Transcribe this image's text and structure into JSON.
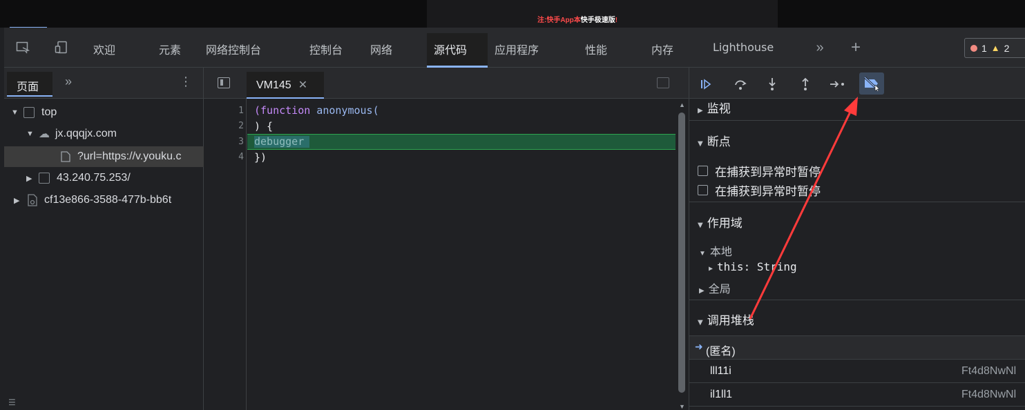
{
  "video": {
    "caption_red": "注:快手App本",
    "caption_white": "快手极速版",
    "caption_tail": "!"
  },
  "main_tabs": [
    {
      "label": "欢迎"
    },
    {
      "label": "元素"
    },
    {
      "label": "网络控制台"
    },
    {
      "label": "控制台"
    },
    {
      "label": "网络"
    },
    {
      "label": "源代码"
    },
    {
      "label": "应用程序"
    },
    {
      "label": "性能"
    },
    {
      "label": "内存"
    },
    {
      "label": "Lighthouse"
    }
  ],
  "active_tab": "源代码",
  "issues": {
    "errors": "1",
    "warnings": "2",
    "error_color": "#f28b82",
    "warning_color": "#fdd663"
  },
  "navigator": {
    "tab_label": "页面",
    "tree": [
      {
        "label": "top"
      },
      {
        "label": "jx.qqqjx.com"
      },
      {
        "label": "?url=https://v.youku.c"
      },
      {
        "label": "43.240.75.253/"
      },
      {
        "label": "cf13e866-3588-477b-bb6t"
      }
    ]
  },
  "editor": {
    "file_tab": "VM145",
    "lines": [
      {
        "num": "1",
        "kw": "(function",
        "rest": " anonymous("
      },
      {
        "num": "2",
        "text": ") {"
      },
      {
        "num": "3",
        "text": "debugger"
      },
      {
        "num": "4",
        "text": "})"
      }
    ],
    "exec_line_color": "#1e5a3a"
  },
  "debugger": {
    "watch": "监视",
    "breakpoints": "断点",
    "pause_caught": "在捕获到异常时暂停",
    "pause_uncaught": "在捕获到异常时暂停",
    "scope": "作用域",
    "local": "本地",
    "this_key": "this:",
    "this_val": "String",
    "global": "全局",
    "call_stack": "调用堆栈",
    "frames": [
      {
        "name": "(匿名)",
        "loc": ""
      },
      {
        "name": "lll11i",
        "loc": "Ft4d8NwNl"
      },
      {
        "name": "il1ll1",
        "loc": "Ft4d8NwNl"
      }
    ]
  },
  "annotation_color": "#ff3b3b"
}
